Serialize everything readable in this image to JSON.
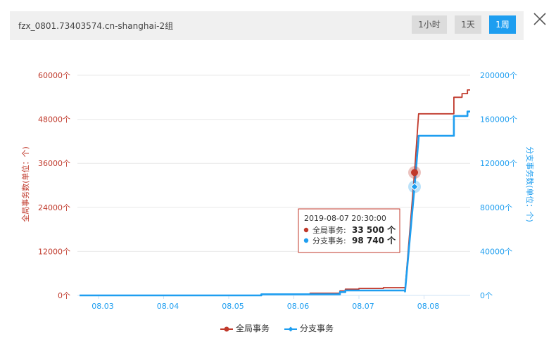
{
  "header": {
    "title": "fzx_0801.73403574.cn-shanghai-2组",
    "ranges": [
      "1小时",
      "1天",
      "1周"
    ],
    "active_range": "1周"
  },
  "colors": {
    "left_series": "#c0392b",
    "right_series": "#1e9ef0"
  },
  "chart_data": {
    "type": "line",
    "x_tick_labels": [
      "08.03",
      "08.04",
      "08.05",
      "08.06",
      "08.07",
      "08.08"
    ],
    "y_left": {
      "label": "全局事务数(单位：个)",
      "ticks": [
        "0个",
        "12000个",
        "24000个",
        "36000个",
        "48000个",
        "60000个"
      ],
      "range": [
        0,
        60000
      ]
    },
    "y_right": {
      "label": "分支事务数(单位：个)",
      "ticks": [
        "0个",
        "40000个",
        "80000个",
        "120000个",
        "160000个",
        "200000个"
      ],
      "range": [
        0,
        200000
      ]
    },
    "grid": true,
    "legend_position": "bottom-center",
    "series": [
      {
        "name": "全局事务",
        "axis": "left",
        "x": [
          "08.02 17:00",
          "08.05 12:00",
          "08.05 12:00",
          "08.06 06:00",
          "08.06 06:00",
          "08.06 17:00",
          "08.06 17:00",
          "08.06 19:00",
          "08.06 19:00",
          "08.07 00:00",
          "08.07 00:00",
          "08.07 09:00",
          "08.07 09:00",
          "08.07 17:00",
          "08.07 17:00",
          "08.07 20:30",
          "08.07 22:00",
          "08.07 22:00",
          "08.08 11:00",
          "08.08 11:00",
          "08.08 14:00",
          "08.08 14:00",
          "08.08 16:00",
          "08.08 16:00",
          "08.08 17:00"
        ],
        "values": [
          0,
          0,
          300,
          300,
          600,
          600,
          1200,
          1200,
          1700,
          1700,
          1900,
          1900,
          2100,
          2100,
          1500,
          33500,
          49500,
          49500,
          49500,
          54000,
          54000,
          55000,
          55000,
          56000,
          56000
        ]
      },
      {
        "name": "分支事务",
        "axis": "right",
        "x": [
          "08.02 17:00",
          "08.05 12:00",
          "08.05 12:00",
          "08.06 17:00",
          "08.06 17:00",
          "08.06 19:00",
          "08.06 19:00",
          "08.07 17:00",
          "08.07 17:00",
          "08.07 20:30",
          "08.07 22:00",
          "08.07 22:00",
          "08.08 11:00",
          "08.08 11:00",
          "08.08 16:00",
          "08.08 16:00",
          "08.08 17:00"
        ],
        "values": [
          0,
          0,
          1000,
          1000,
          3000,
          3000,
          4500,
          4500,
          3500,
          98740,
          143000,
          145000,
          145000,
          163000,
          163000,
          167000,
          167000
        ]
      }
    ],
    "tooltip": {
      "time": "2019-08-07 20:30:00",
      "rows": [
        {
          "label": "全局事务:",
          "value": "33 500 个"
        },
        {
          "label": "分支事务:",
          "value": "98 740 个"
        }
      ],
      "highlight_x": "08.07 20:30",
      "highlight_left_value": 33500,
      "highlight_right_value": 98740
    }
  }
}
